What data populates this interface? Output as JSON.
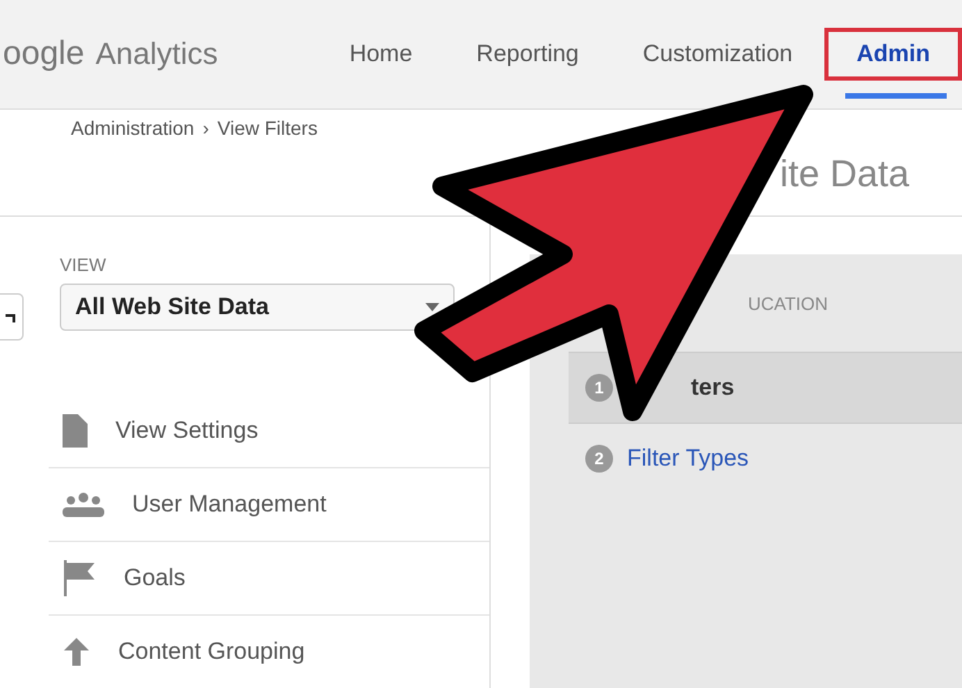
{
  "header": {
    "logo": {
      "brand": "oogle",
      "product": "Analytics"
    },
    "nav": [
      {
        "label": "Home",
        "selected": false,
        "highlighted": false
      },
      {
        "label": "Reporting",
        "selected": false,
        "highlighted": false
      },
      {
        "label": "Customization",
        "selected": false,
        "highlighted": false
      },
      {
        "label": "Admin",
        "selected": true,
        "highlighted": true
      }
    ]
  },
  "breadcrumb": [
    "Administration",
    "View Filters"
  ],
  "breadcrumb_separator": "›",
  "page_title": "ite Data",
  "view": {
    "label": "VIEW",
    "value": "All Web Site Data"
  },
  "menu": [
    {
      "label": "View Settings"
    },
    {
      "label": "User Management"
    },
    {
      "label": "Goals"
    },
    {
      "label": "Content Grouping"
    }
  ],
  "panel": {
    "heading": "UCATION",
    "steps": [
      {
        "number": "1",
        "label": "ters",
        "selected": true
      },
      {
        "number": "2",
        "label": "Filter Types",
        "selected": false
      }
    ]
  }
}
